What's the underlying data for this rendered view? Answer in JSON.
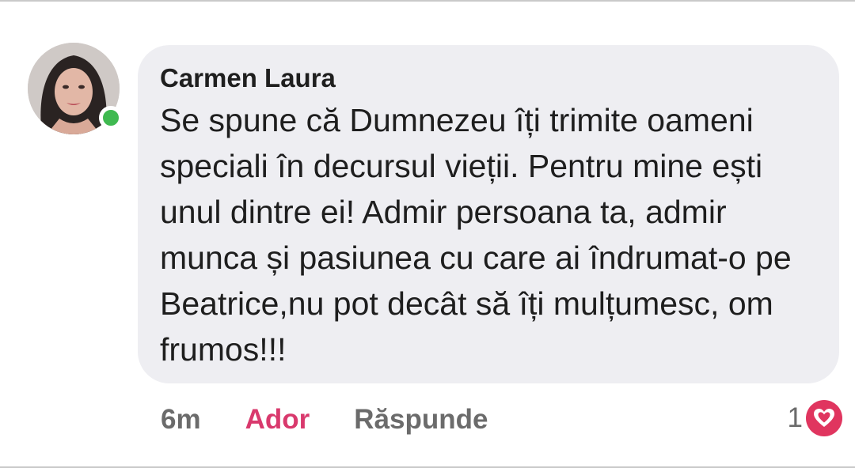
{
  "comment": {
    "author": "Carmen Laura",
    "text": "Se spune că Dumnezeu îți trimite oameni speciali în decursul vieții. Pentru mine ești unul dintre ei! Admir persoana ta, admir munca și pasiunea cu care ai îndrumat-o pe Beatrice,nu pot decât să îți mulțumesc, om frumos!!!",
    "online_status_color": "#3fb950"
  },
  "actions": {
    "time": "6m",
    "react_label": "Ador",
    "reply_label": "Răspunde"
  },
  "reactions": {
    "count": "1",
    "icon": "heart-care-icon",
    "color": "#e0355f"
  },
  "colors": {
    "bubble": "#eeeef2",
    "accent": "#d9396d"
  }
}
